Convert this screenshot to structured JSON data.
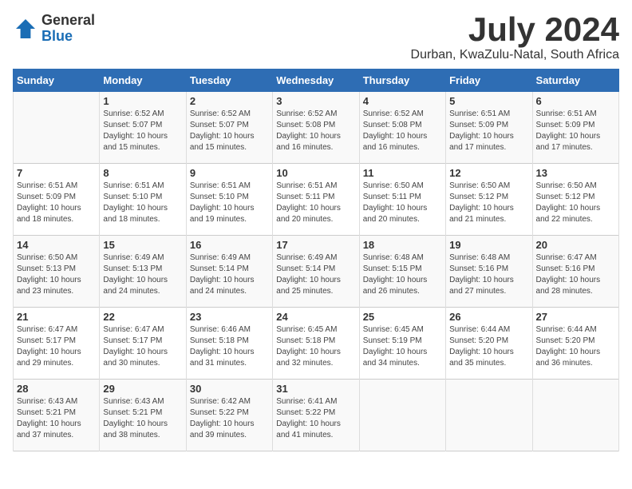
{
  "logo": {
    "general": "General",
    "blue": "Blue"
  },
  "title": {
    "month_year": "July 2024",
    "location": "Durban, KwaZulu-Natal, South Africa"
  },
  "days_of_week": [
    "Sunday",
    "Monday",
    "Tuesday",
    "Wednesday",
    "Thursday",
    "Friday",
    "Saturday"
  ],
  "weeks": [
    [
      {
        "day": "",
        "sunrise": "",
        "sunset": "",
        "daylight": ""
      },
      {
        "day": "1",
        "sunrise": "Sunrise: 6:52 AM",
        "sunset": "Sunset: 5:07 PM",
        "daylight": "Daylight: 10 hours and 15 minutes."
      },
      {
        "day": "2",
        "sunrise": "Sunrise: 6:52 AM",
        "sunset": "Sunset: 5:07 PM",
        "daylight": "Daylight: 10 hours and 15 minutes."
      },
      {
        "day": "3",
        "sunrise": "Sunrise: 6:52 AM",
        "sunset": "Sunset: 5:08 PM",
        "daylight": "Daylight: 10 hours and 16 minutes."
      },
      {
        "day": "4",
        "sunrise": "Sunrise: 6:52 AM",
        "sunset": "Sunset: 5:08 PM",
        "daylight": "Daylight: 10 hours and 16 minutes."
      },
      {
        "day": "5",
        "sunrise": "Sunrise: 6:51 AM",
        "sunset": "Sunset: 5:09 PM",
        "daylight": "Daylight: 10 hours and 17 minutes."
      },
      {
        "day": "6",
        "sunrise": "Sunrise: 6:51 AM",
        "sunset": "Sunset: 5:09 PM",
        "daylight": "Daylight: 10 hours and 17 minutes."
      }
    ],
    [
      {
        "day": "7",
        "sunrise": "Sunrise: 6:51 AM",
        "sunset": "Sunset: 5:09 PM",
        "daylight": "Daylight: 10 hours and 18 minutes."
      },
      {
        "day": "8",
        "sunrise": "Sunrise: 6:51 AM",
        "sunset": "Sunset: 5:10 PM",
        "daylight": "Daylight: 10 hours and 18 minutes."
      },
      {
        "day": "9",
        "sunrise": "Sunrise: 6:51 AM",
        "sunset": "Sunset: 5:10 PM",
        "daylight": "Daylight: 10 hours and 19 minutes."
      },
      {
        "day": "10",
        "sunrise": "Sunrise: 6:51 AM",
        "sunset": "Sunset: 5:11 PM",
        "daylight": "Daylight: 10 hours and 20 minutes."
      },
      {
        "day": "11",
        "sunrise": "Sunrise: 6:50 AM",
        "sunset": "Sunset: 5:11 PM",
        "daylight": "Daylight: 10 hours and 20 minutes."
      },
      {
        "day": "12",
        "sunrise": "Sunrise: 6:50 AM",
        "sunset": "Sunset: 5:12 PM",
        "daylight": "Daylight: 10 hours and 21 minutes."
      },
      {
        "day": "13",
        "sunrise": "Sunrise: 6:50 AM",
        "sunset": "Sunset: 5:12 PM",
        "daylight": "Daylight: 10 hours and 22 minutes."
      }
    ],
    [
      {
        "day": "14",
        "sunrise": "Sunrise: 6:50 AM",
        "sunset": "Sunset: 5:13 PM",
        "daylight": "Daylight: 10 hours and 23 minutes."
      },
      {
        "day": "15",
        "sunrise": "Sunrise: 6:49 AM",
        "sunset": "Sunset: 5:13 PM",
        "daylight": "Daylight: 10 hours and 24 minutes."
      },
      {
        "day": "16",
        "sunrise": "Sunrise: 6:49 AM",
        "sunset": "Sunset: 5:14 PM",
        "daylight": "Daylight: 10 hours and 24 minutes."
      },
      {
        "day": "17",
        "sunrise": "Sunrise: 6:49 AM",
        "sunset": "Sunset: 5:14 PM",
        "daylight": "Daylight: 10 hours and 25 minutes."
      },
      {
        "day": "18",
        "sunrise": "Sunrise: 6:48 AM",
        "sunset": "Sunset: 5:15 PM",
        "daylight": "Daylight: 10 hours and 26 minutes."
      },
      {
        "day": "19",
        "sunrise": "Sunrise: 6:48 AM",
        "sunset": "Sunset: 5:16 PM",
        "daylight": "Daylight: 10 hours and 27 minutes."
      },
      {
        "day": "20",
        "sunrise": "Sunrise: 6:47 AM",
        "sunset": "Sunset: 5:16 PM",
        "daylight": "Daylight: 10 hours and 28 minutes."
      }
    ],
    [
      {
        "day": "21",
        "sunrise": "Sunrise: 6:47 AM",
        "sunset": "Sunset: 5:17 PM",
        "daylight": "Daylight: 10 hours and 29 minutes."
      },
      {
        "day": "22",
        "sunrise": "Sunrise: 6:47 AM",
        "sunset": "Sunset: 5:17 PM",
        "daylight": "Daylight: 10 hours and 30 minutes."
      },
      {
        "day": "23",
        "sunrise": "Sunrise: 6:46 AM",
        "sunset": "Sunset: 5:18 PM",
        "daylight": "Daylight: 10 hours and 31 minutes."
      },
      {
        "day": "24",
        "sunrise": "Sunrise: 6:45 AM",
        "sunset": "Sunset: 5:18 PM",
        "daylight": "Daylight: 10 hours and 32 minutes."
      },
      {
        "day": "25",
        "sunrise": "Sunrise: 6:45 AM",
        "sunset": "Sunset: 5:19 PM",
        "daylight": "Daylight: 10 hours and 34 minutes."
      },
      {
        "day": "26",
        "sunrise": "Sunrise: 6:44 AM",
        "sunset": "Sunset: 5:20 PM",
        "daylight": "Daylight: 10 hours and 35 minutes."
      },
      {
        "day": "27",
        "sunrise": "Sunrise: 6:44 AM",
        "sunset": "Sunset: 5:20 PM",
        "daylight": "Daylight: 10 hours and 36 minutes."
      }
    ],
    [
      {
        "day": "28",
        "sunrise": "Sunrise: 6:43 AM",
        "sunset": "Sunset: 5:21 PM",
        "daylight": "Daylight: 10 hours and 37 minutes."
      },
      {
        "day": "29",
        "sunrise": "Sunrise: 6:43 AM",
        "sunset": "Sunset: 5:21 PM",
        "daylight": "Daylight: 10 hours and 38 minutes."
      },
      {
        "day": "30",
        "sunrise": "Sunrise: 6:42 AM",
        "sunset": "Sunset: 5:22 PM",
        "daylight": "Daylight: 10 hours and 39 minutes."
      },
      {
        "day": "31",
        "sunrise": "Sunrise: 6:41 AM",
        "sunset": "Sunset: 5:22 PM",
        "daylight": "Daylight: 10 hours and 41 minutes."
      },
      {
        "day": "",
        "sunrise": "",
        "sunset": "",
        "daylight": ""
      },
      {
        "day": "",
        "sunrise": "",
        "sunset": "",
        "daylight": ""
      },
      {
        "day": "",
        "sunrise": "",
        "sunset": "",
        "daylight": ""
      }
    ]
  ]
}
